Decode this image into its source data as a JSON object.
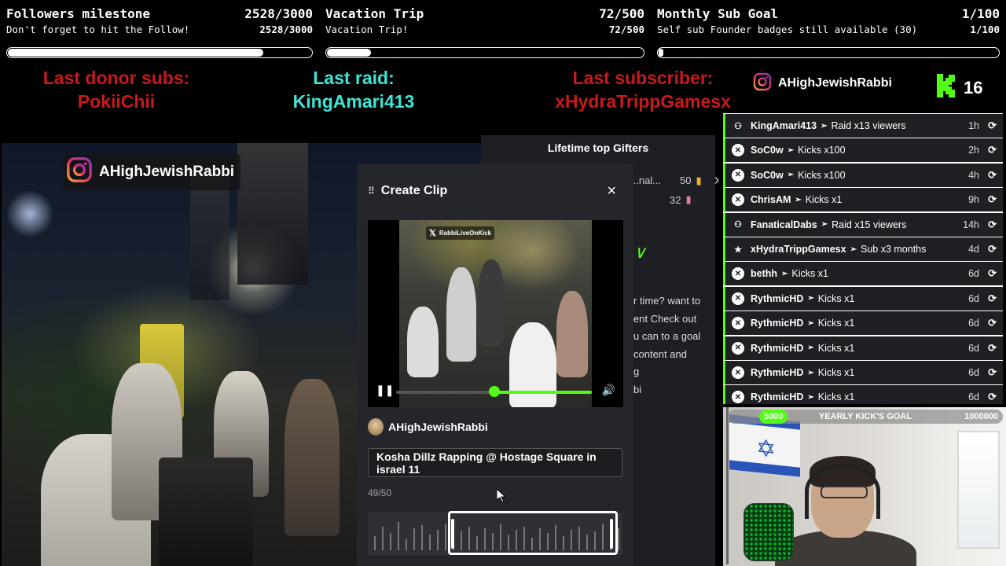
{
  "goals": [
    {
      "title": "Followers milestone",
      "count": "2528/3000",
      "subtitle": "Don't forget to hit the Follow!",
      "subcount": "2528/3000",
      "progress": 0.843
    },
    {
      "title": "Vacation Trip",
      "count": "72/500",
      "subtitle": "Vacation Trip!",
      "subcount": "72/500",
      "progress": 0.144
    },
    {
      "title": "Monthly Sub Goal",
      "count": "1/100",
      "subtitle": "Self sub Founder badges still available (30)",
      "subcount": "1/100",
      "progress": 0.01
    }
  ],
  "last": {
    "donor_label": "Last donor subs:",
    "donor_name": "PokiiChii",
    "raid_label": "Last raid:",
    "raid_name": "KingAmari413",
    "sub_label": "Last subscriber:",
    "sub_name": "xHydraTrippGamesx"
  },
  "social": {
    "instagram_handle": "AHighJewishRabbi",
    "kick_count": "16"
  },
  "stream_overlay": {
    "instagram_handle": "AHighJewishRabbi"
  },
  "gifters_panel": {
    "title": "Lifetime top Gifters",
    "rows": [
      {
        "name": "...nal...",
        "value": "50"
      },
      {
        "name": "",
        "value": "32"
      }
    ],
    "description_lines": [
      "r time? want to",
      "ent Check out",
      "u can to a goal",
      "content and",
      "g",
      "bi"
    ]
  },
  "clip_modal": {
    "title": "Create Clip",
    "close": "×",
    "watermark": "RabbiLiveOnKick",
    "username": "AHighJewishRabbi",
    "clip_title": "Kosha Dillz Rapping @ Hostage Square in israel 11",
    "char_count": "49/50",
    "playback_progress": 0.5
  },
  "events": [
    {
      "icon": "raid-icon",
      "user": "KingAmari413",
      "action": "Raid x13 viewers",
      "time": "1h"
    },
    {
      "icon": "kicks-icon",
      "user": "SoC0w",
      "action": "Kicks x100",
      "time": "2h"
    },
    {
      "icon": "kicks-icon",
      "user": "SoC0w",
      "action": "Kicks x100",
      "time": "4h"
    },
    {
      "icon": "kicks-icon",
      "user": "ChrisAM",
      "action": "Kicks x1",
      "time": "9h"
    },
    {
      "icon": "raid-icon",
      "user": "FanaticalDabs",
      "action": "Raid x15 viewers",
      "time": "14h"
    },
    {
      "icon": "star-icon",
      "user": "xHydraTrippGamesx",
      "action": "Sub x3 months",
      "time": "4d"
    },
    {
      "icon": "kicks-icon",
      "user": "bethh",
      "action": "Kicks x1",
      "time": "6d"
    },
    {
      "icon": "kicks-icon",
      "user": "RythmicHD",
      "action": "Kicks x1",
      "time": "6d"
    },
    {
      "icon": "kicks-icon",
      "user": "RythmicHD",
      "action": "Kicks x1",
      "time": "6d"
    },
    {
      "icon": "kicks-icon",
      "user": "RythmicHD",
      "action": "Kicks x1",
      "time": "6d"
    },
    {
      "icon": "kicks-icon",
      "user": "RythmicHD",
      "action": "Kicks x1",
      "time": "6d"
    },
    {
      "icon": "kicks-icon",
      "user": "RythmicHD",
      "action": "Kicks x1",
      "time": "6d"
    }
  ],
  "yearly_goal": {
    "start": "5000",
    "label": "YEARLY KICK'S GOAL",
    "end": "1000000"
  },
  "colors": {
    "kick_green": "#53fc18",
    "alert_red": "#c81a1a",
    "raid_teal": "#3de6d6",
    "panel_dark": "#1f2024"
  }
}
